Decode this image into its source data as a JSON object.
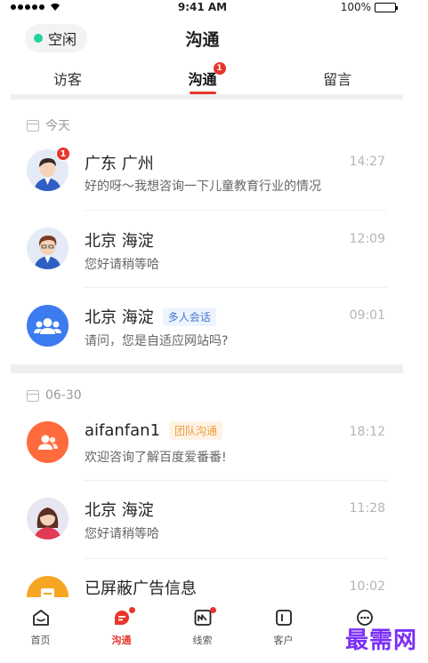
{
  "status_bar": {
    "time": "9:41 AM",
    "battery": "100%"
  },
  "header": {
    "status_label": "空闲",
    "title": "沟通"
  },
  "tabs": [
    {
      "label": "访客",
      "active": false
    },
    {
      "label": "沟通",
      "active": true,
      "badge": "1"
    },
    {
      "label": "留言",
      "active": false
    }
  ],
  "sections": [
    {
      "date": "今天"
    },
    {
      "date": "06-30"
    }
  ],
  "conversations": [
    {
      "title": "广东 广州",
      "time": "14:27",
      "subtitle": "好的呀～我想咨询一下儿童教育行业的情况",
      "badge": "1",
      "avatar": "male-avatar"
    },
    {
      "title": "北京 海淀",
      "time": "12:09",
      "subtitle": "您好请稍等哈",
      "avatar": "male-avatar"
    },
    {
      "title": "北京 海淀",
      "tag": "多人会话",
      "time": "09:01",
      "subtitle": "请问，您是自适应网站吗?",
      "avatar": "group-icon",
      "avatar_color": "#3c7bf0"
    },
    {
      "title": "aifanfan1",
      "tag": "团队沟通",
      "time": "18:12",
      "subtitle": "欢迎咨询了解百度爱番番!",
      "avatar": "team-icon",
      "avatar_color": "#ff6b3d"
    },
    {
      "title": "北京 海淀",
      "time": "11:28",
      "subtitle": "您好请稍等哈",
      "avatar": "female-avatar"
    },
    {
      "title": "已屏蔽广告信息",
      "time": "10:02",
      "avatar": "blocked-icon",
      "avatar_color": "#f6a623"
    }
  ],
  "bottom_nav": [
    {
      "label": "首页",
      "icon": "home-icon"
    },
    {
      "label": "沟通",
      "icon": "chat-icon",
      "active": true,
      "dot": true
    },
    {
      "label": "线索",
      "icon": "leads-icon",
      "dot": true
    },
    {
      "label": "客户",
      "icon": "customer-icon"
    },
    {
      "label": "",
      "icon": "more-icon"
    }
  ],
  "watermark": "最需网",
  "colors": {
    "accent": "#e8352c",
    "online": "#21d19f",
    "blue": "#3c7bf0",
    "orange": "#ff6b3d",
    "yellow": "#f6a623"
  }
}
